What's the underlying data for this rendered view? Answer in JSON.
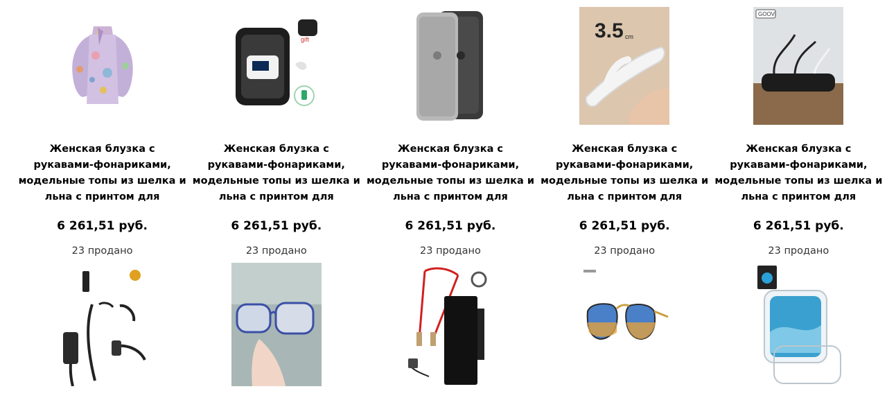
{
  "products": [
    {
      "title": "Женская блузка с рукавами-фонариками, модельные топы из шелка и льна с принтом для вечерние",
      "price": "6 261,51 руб.",
      "sold": "23 продано",
      "image": "floral-blouse-image"
    },
    {
      "title": "Женская блузка с рукавами-фонариками, модельные топы из шелка и льна с принтом для вечерние",
      "price": "6 261,51 руб.",
      "sold": "23 продано",
      "image": "pulse-oximeter-case-image",
      "image_text": "gift"
    },
    {
      "title": "Женская блузка с рукавами-фонариками, модельные топы из шелка и льна с принтом для вечерние",
      "price": "6 261,51 руб.",
      "sold": "23 продано",
      "image": "phone-case-image"
    },
    {
      "title": "Женская блузка с рукавами-фонариками, модельные топы из шелка и льна с принтом для вечерние",
      "price": "6 261,51 руб.",
      "sold": "23 продано",
      "image": "flip-flop-slipper-image",
      "image_text": "3.5",
      "image_unit": "cm"
    },
    {
      "title": "Женская блузка с рукавами-фонариками, модельные топы из шелка и льна с принтом для вечерние",
      "price": "6 261,51 руб.",
      "sold": "23 продано",
      "image": "cable-organizer-image",
      "image_text": "GOOVI"
    }
  ],
  "row2_images": [
    {
      "image": "charging-cable-image"
    },
    {
      "image": "eyeglasses-image"
    },
    {
      "image": "spot-welder-image"
    },
    {
      "image": "aviator-sunglasses-image"
    },
    {
      "image": "clear-phone-case-image"
    }
  ]
}
